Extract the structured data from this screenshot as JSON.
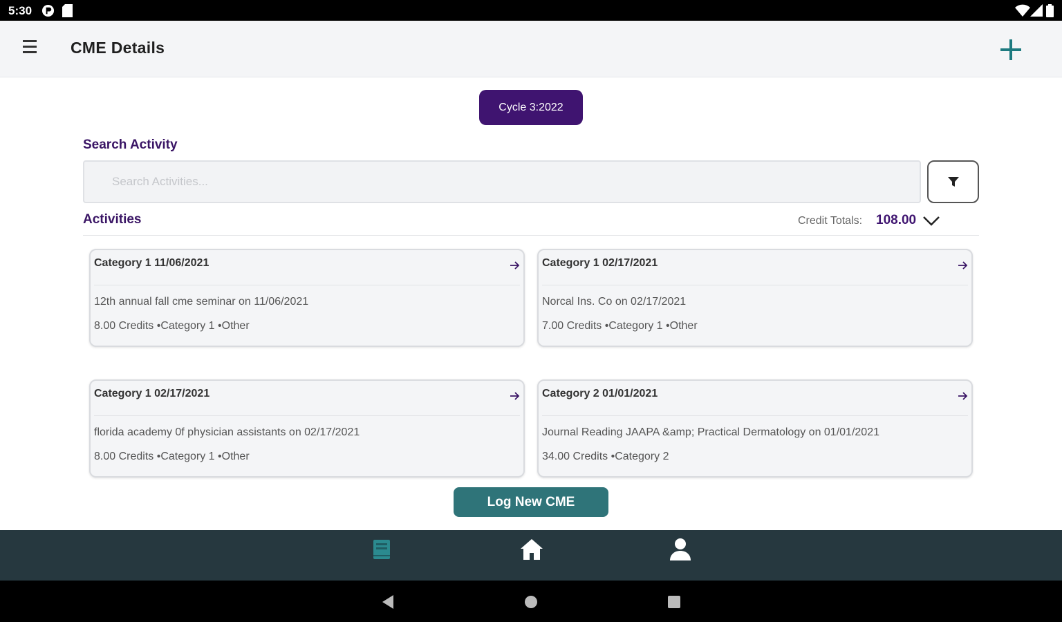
{
  "status_bar": {
    "time": "5:30"
  },
  "header": {
    "title": "CME Details"
  },
  "cycle": {
    "label": "Cycle 3:2022"
  },
  "search": {
    "label": "Search Activity",
    "placeholder": "Search Activities...",
    "value": ""
  },
  "activities": {
    "label": "Activities",
    "credit_totals_label": "Credit Totals:",
    "credit_totals_value": "108.00"
  },
  "cards": [
    {
      "header": "Category 1  11/06/2021",
      "description": "12th annual fall cme seminar on 11/06/2021",
      "meta": "8.00 Credits •Category 1 •Other"
    },
    {
      "header": "Category 1  02/17/2021",
      "description": "Norcal Ins. Co on 02/17/2021",
      "meta": "7.00 Credits •Category 1 •Other"
    },
    {
      "header": "Category 1  02/17/2021",
      "description": "florida academy 0f physician assistants on 02/17/2021",
      "meta": "8.00 Credits •Category 1 •Other"
    },
    {
      "header": "Category 2  01/01/2021",
      "description": "Journal Reading JAAPA &amp; Practical Dermatology on 01/01/2021",
      "meta": "34.00 Credits •Category 2"
    }
  ],
  "actions": {
    "log_new": "Log New CME"
  },
  "icons": {
    "menu": "menu-icon",
    "add": "plus-icon",
    "filter": "filter-icon",
    "chevron": "chevron-down-icon",
    "arrow": "arrow-right-icon",
    "book": "book-icon",
    "home": "home-icon",
    "profile": "person-icon"
  },
  "colors": {
    "primary": "#3f1470",
    "accent": "#2f7479",
    "teal_icon": "#1d7a80",
    "bottom_bar": "#26383f"
  }
}
